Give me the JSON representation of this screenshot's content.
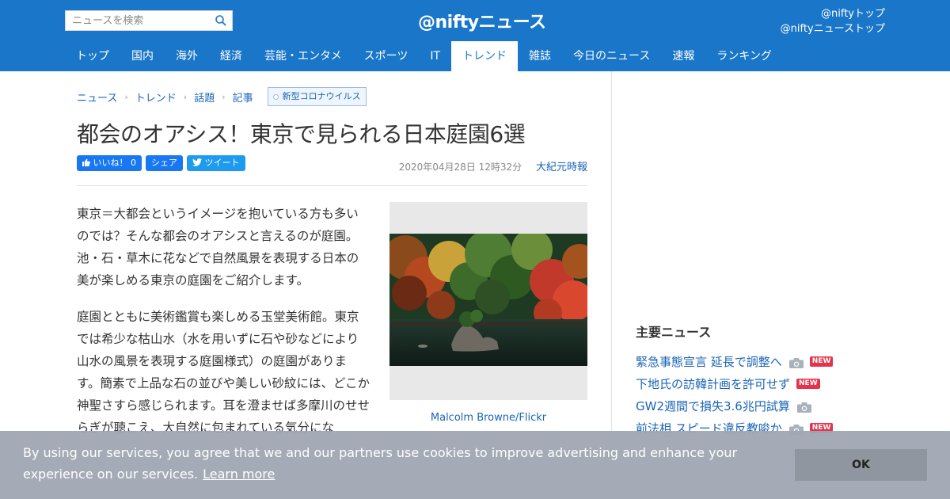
{
  "search": {
    "placeholder": "ニュースを検索"
  },
  "header": {
    "logo": "@niftyニュース",
    "links": [
      "@niftyトップ",
      "@niftyニューストップ"
    ]
  },
  "nav": {
    "items": [
      "トップ",
      "国内",
      "海外",
      "経済",
      "芸能・エンタメ",
      "スポーツ",
      "IT",
      "トレンド",
      "雑誌",
      "今日のニュース",
      "速報",
      "ランキング"
    ],
    "active": "トレンド"
  },
  "breadcrumb": [
    "ニュース",
    "トレンド",
    "話題",
    "記事"
  ],
  "tag": "新型コロナウイルス",
  "article": {
    "title": "都会のオアシス！東京で見られる日本庭園6選",
    "like_label": "いいね！ 0",
    "share_label": "シェア",
    "tweet_label": "ツイート",
    "date": "2020年04月28日 12時32分",
    "source": "大紀元時報",
    "paragraphs": [
      "東京＝大都会というイメージを抱いている方も多いのでは？そんな都会のオアシスと言えるのが庭園。池・石・草木に花などで自然風景を表現する日本の美が楽しめる東京の庭園をご紹介します。",
      "庭園とともに美術鑑賞も楽しめる玉堂美術館。東京では希少な枯山水（水を用いずに石や砂などにより山水の風景を表現する庭園様式）の庭園があります。簡素で上品な石の並びや美しい砂紋には、どこか神聖さすら感じられます。耳を澄ませば多摩川のせせらぎが聴こえ、大自然に包まれている気分にな"
    ],
    "photo_credit": "Malcolm Browne/Flickr"
  },
  "sidebar": {
    "heading": "主要ニュース",
    "items": [
      {
        "title": "緊急事態宣言 延長で調整へ",
        "camera": true,
        "new": true
      },
      {
        "title": "下地氏の訪韓計画を許可せず",
        "camera": false,
        "new": true
      },
      {
        "title": "GW2週間で損失3.6兆円試算",
        "camera": true,
        "new": false
      },
      {
        "title": "前法相 スピード違反教唆か",
        "camera": true,
        "new": true
      }
    ],
    "new_badge": "NEW"
  },
  "cookie": {
    "message": "By using our services, you agree that we and our partners use cookies to improve advertising and enhance your experience on our services.",
    "learn_more": "Learn more",
    "ok": "OK"
  },
  "icons": {
    "search": "search-icon",
    "camera": "camera-icon",
    "facebook": "facebook-thumb-icon",
    "twitter": "twitter-bird-icon"
  },
  "colors": {
    "header": "#1a76c9",
    "link": "#1a64b8",
    "new_badge": "#e5334b",
    "cookie_bar": "#a0a6b2"
  }
}
